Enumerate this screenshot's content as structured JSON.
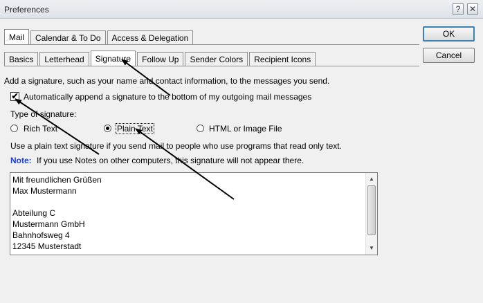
{
  "window": {
    "title": "Preferences",
    "help_glyph": "?",
    "close_glyph": "✕"
  },
  "tabs_main": [
    {
      "label": "Mail",
      "active": true
    },
    {
      "label": "Calendar & To Do",
      "active": false
    },
    {
      "label": "Access & Delegation",
      "active": false
    }
  ],
  "tabs_sub": [
    {
      "label": "Basics",
      "active": false
    },
    {
      "label": "Letterhead",
      "active": false
    },
    {
      "label": "Signature",
      "active": true
    },
    {
      "label": "Follow Up",
      "active": false
    },
    {
      "label": "Sender Colors",
      "active": false
    },
    {
      "label": "Recipient Icons",
      "active": false
    }
  ],
  "buttons": {
    "ok": "OK",
    "cancel": "Cancel"
  },
  "content": {
    "intro": "Add a signature, such as your name and contact information, to the messages you send.",
    "auto_append_label": "Automatically append a signature to the bottom of my outgoing mail messages",
    "auto_append_checked_glyph": "✔",
    "type_label": "Type of signature:",
    "radio_options": [
      {
        "label": "Rich Text",
        "selected": false
      },
      {
        "label": "Plain Text",
        "selected": true
      },
      {
        "label": "HTML or Image File",
        "selected": false
      }
    ],
    "plain_text_hint": "Use a plain text signature if you send mail to people who use programs that read only text.",
    "note_label": "Note:",
    "note_text": "If you use Notes on other computers, this signature will not appear there."
  },
  "signature_lines": [
    "Mit freundlichen Grüßen",
    "Max Mustermann",
    "",
    "Abteilung C",
    "Mustermann GmbH",
    "Bahnhofsweg 4",
    "12345 Musterstadt"
  ],
  "scroll": {
    "up_glyph": "▲",
    "down_glyph": "▼"
  },
  "colors": {
    "note": "#1f3fd1",
    "arrow": "#000000"
  }
}
